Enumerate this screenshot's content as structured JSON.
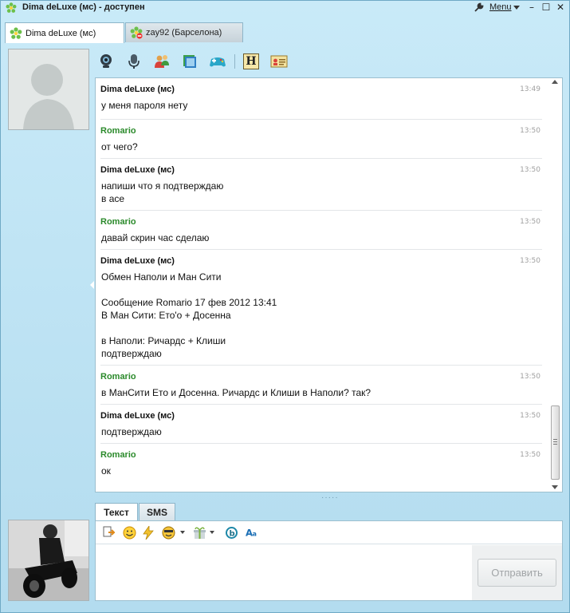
{
  "window": {
    "title": "Dima deLuxe (мс) - доступен",
    "menu_label": "Menu",
    "minimize_glyph": "–",
    "maximize_glyph": "☐",
    "close_glyph": "✕"
  },
  "tabs": [
    {
      "label": "Dima deLuxe (мс)",
      "status": "online",
      "active": true
    },
    {
      "label": "zay92 (Барселона)",
      "status": "blocked",
      "active": false
    }
  ],
  "toolbar": {
    "icons": [
      "webcam-icon",
      "microphone-icon",
      "contacts-icon",
      "folders-icon",
      "gamepad-icon",
      "history-icon",
      "contact-card-icon"
    ],
    "history_glyph": "H"
  },
  "messages": [
    {
      "author": "Dima deLuxe (мс)",
      "from_me": true,
      "time": "13:49",
      "text": "у меня пароля нету"
    },
    {
      "author": "Romario",
      "from_me": false,
      "time": "13:50",
      "text": "от чего?"
    },
    {
      "author": "Dima deLuxe (мс)",
      "from_me": true,
      "time": "13:50",
      "text": "напиши что я подтверждаю\nв асе"
    },
    {
      "author": "Romario",
      "from_me": false,
      "time": "13:50",
      "text": "давай скрин час сделаю"
    },
    {
      "author": "Dima deLuxe (мс)",
      "from_me": true,
      "time": "13:50",
      "text": "Обмен Наполи и Ман Сити\n\nСообщение Romario 17 фев 2012 13:41\nВ Ман Сити: Ето'о + Досенна\n\nв Наполи: Ричардс + Клиши\nподтверждаю"
    },
    {
      "author": "Romario",
      "from_me": false,
      "time": "13:50",
      "text": "в МанСити Ето и Досенна. Ричардс и Клиши в Наполи? так?"
    },
    {
      "author": "Dima deLuxe (мс)",
      "from_me": true,
      "time": "13:50",
      "text": "подтверждаю"
    },
    {
      "author": "Romario",
      "from_me": false,
      "time": "13:50",
      "text": "ок"
    }
  ],
  "input_tabs": [
    {
      "label": "Текст",
      "active": true
    },
    {
      "label": "SMS",
      "active": false
    }
  ],
  "compose": {
    "value": "",
    "send_label": "Отправить",
    "icons": [
      "send-file-icon",
      "smiley-icon",
      "lightning-icon",
      "animated-smiley-icon",
      "gift-icon",
      "bold-b-icon",
      "font-icon"
    ]
  },
  "colors": {
    "window_bg": "#b9e1f3",
    "other_author": "#2b8a2b",
    "my_author": "#111111",
    "timestamp": "#a0a0a0"
  }
}
